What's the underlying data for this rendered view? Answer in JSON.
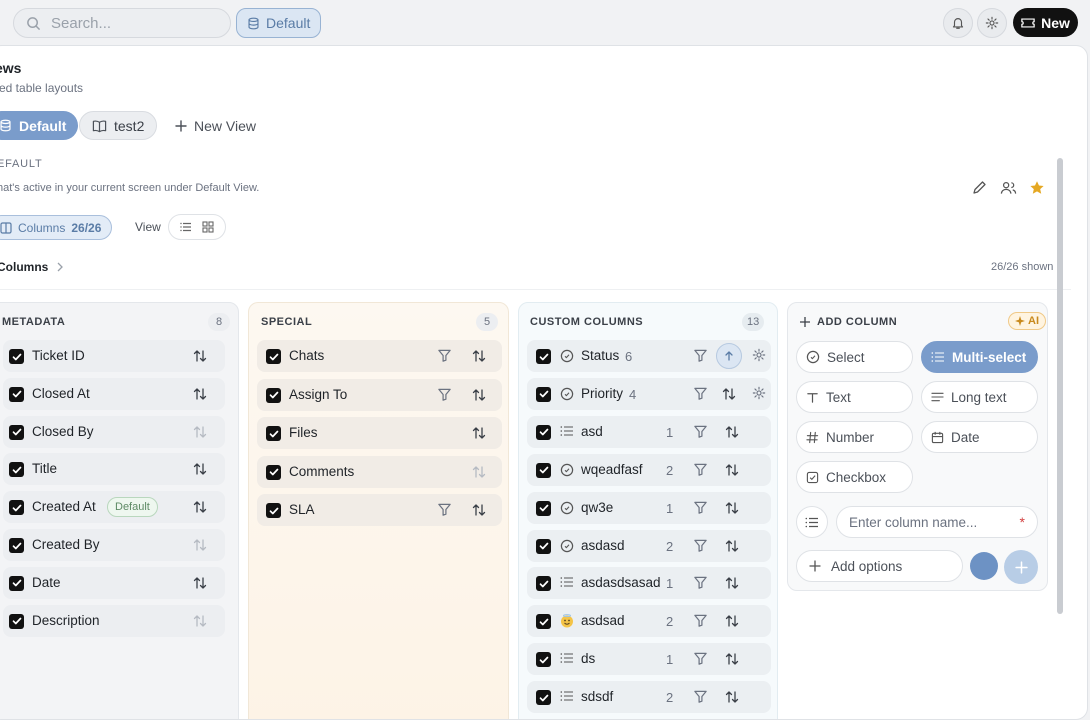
{
  "topbar": {
    "search_placeholder": "Search...",
    "view_button": "Default",
    "new_button": "New"
  },
  "header": {
    "title": "ews",
    "subtitle": "ved table layouts"
  },
  "views": [
    {
      "label": "Default",
      "selected": true
    },
    {
      "label": "test2",
      "selected": false
    }
  ],
  "new_view_label": "New View",
  "current_view": {
    "name": "EFAULT",
    "description": "hat's active in your current screen under Default View.",
    "columns_badge_label": "Columns",
    "columns_badge_count": "26/26",
    "view_label": "View"
  },
  "columns_section": {
    "title": "Columns",
    "shown": "26/26 shown"
  },
  "groups": {
    "metadata": {
      "title": "METADATA",
      "count": "8",
      "items": [
        {
          "label": "Ticket ID",
          "sort_active": true
        },
        {
          "label": "Closed At",
          "sort_active": true
        },
        {
          "label": "Closed By",
          "sort_active": false
        },
        {
          "label": "Title",
          "sort_active": true
        },
        {
          "label": "Created At",
          "badge": "Default",
          "sort_active": true
        },
        {
          "label": "Created By",
          "sort_active": false
        },
        {
          "label": "Date",
          "sort_active": true
        },
        {
          "label": "Description",
          "sort_active": false
        }
      ]
    },
    "special": {
      "title": "SPECIAL",
      "count": "5",
      "items": [
        {
          "label": "Chats",
          "filter": true,
          "sort_active": true
        },
        {
          "label": "Assign To",
          "filter": true,
          "sort_active": true
        },
        {
          "label": "Files",
          "filter": false,
          "sort_active": true
        },
        {
          "label": "Comments",
          "filter": false,
          "sort_active": false
        },
        {
          "label": "SLA",
          "filter": true,
          "sort_active": true
        }
      ]
    },
    "custom": {
      "title": "CUSTOM COLUMNS",
      "count": "13",
      "items": [
        {
          "label": "Status",
          "type_icon": "circle-select-icon",
          "count": "6"
        },
        {
          "label": "Priority",
          "type_icon": "circle-select-icon",
          "count": "4"
        },
        {
          "label": "asd",
          "type_icon": "list-icon",
          "count": "1"
        },
        {
          "label": "wqeadfasf",
          "type_icon": "circle-select-icon",
          "count": "2"
        },
        {
          "label": "qw3e",
          "type_icon": "circle-select-icon",
          "count": "1"
        },
        {
          "label": "asdasd",
          "type_icon": "circle-select-icon",
          "count": "2"
        },
        {
          "label": "asdasdsasad",
          "type_icon": "list-icon",
          "count": "1"
        },
        {
          "label": "asdsad",
          "type_icon": "emoji-icon",
          "count": "2"
        },
        {
          "label": "ds",
          "type_icon": "list-icon",
          "count": "1"
        },
        {
          "label": "sdsdf",
          "type_icon": "list-icon",
          "count": "2"
        }
      ]
    }
  },
  "add_column": {
    "title": "ADD COLUMN",
    "ai_label": "AI",
    "types": [
      {
        "label": "Select",
        "icon": "circle-select-icon",
        "selected": false
      },
      {
        "label": "Multi-select",
        "icon": "list-icon",
        "selected": true
      },
      {
        "label": "Text",
        "icon": "text-icon",
        "selected": false
      },
      {
        "label": "Long text",
        "icon": "long-text-icon",
        "selected": false
      },
      {
        "label": "Number",
        "icon": "hash-icon",
        "selected": false
      },
      {
        "label": "Date",
        "icon": "calendar-icon",
        "selected": false
      },
      {
        "label": "Checkbox",
        "icon": "checkbox-icon",
        "selected": false
      }
    ],
    "name_placeholder": "Enter column name...",
    "required_mark": "*",
    "add_options_label": "Add options"
  },
  "colors": {
    "accent": "#7a9ccb",
    "color_swatch": "#6d92c4",
    "star": "#e5a823",
    "dark_button": "#111111"
  }
}
